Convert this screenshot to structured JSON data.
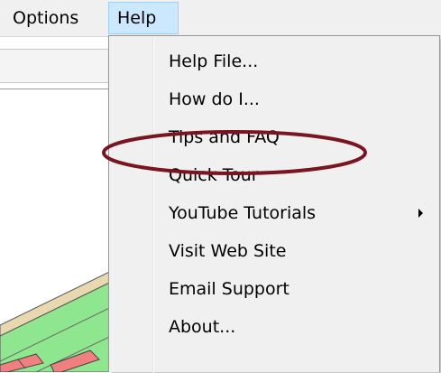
{
  "menubar": {
    "items": [
      {
        "label": "Options"
      },
      {
        "label": "Help"
      }
    ]
  },
  "help_menu": {
    "items": [
      {
        "label": "Help File..."
      },
      {
        "label": "How do I..."
      },
      {
        "label": "Tips and FAQ"
      },
      {
        "label": "Quick Tour"
      },
      {
        "label": "YouTube Tutorials"
      },
      {
        "label": "Visit Web Site"
      },
      {
        "label": "Email Support"
      },
      {
        "label": "About..."
      }
    ],
    "highlighted_item": "Tips and FAQ"
  },
  "colors": {
    "highlight_ellipse": "#7a1420",
    "menu_selected_bg": "#cce8ff",
    "drawing_green": "#8ee68e",
    "drawing_red": "#f08080",
    "drawing_tan": "#e8d8b0"
  }
}
